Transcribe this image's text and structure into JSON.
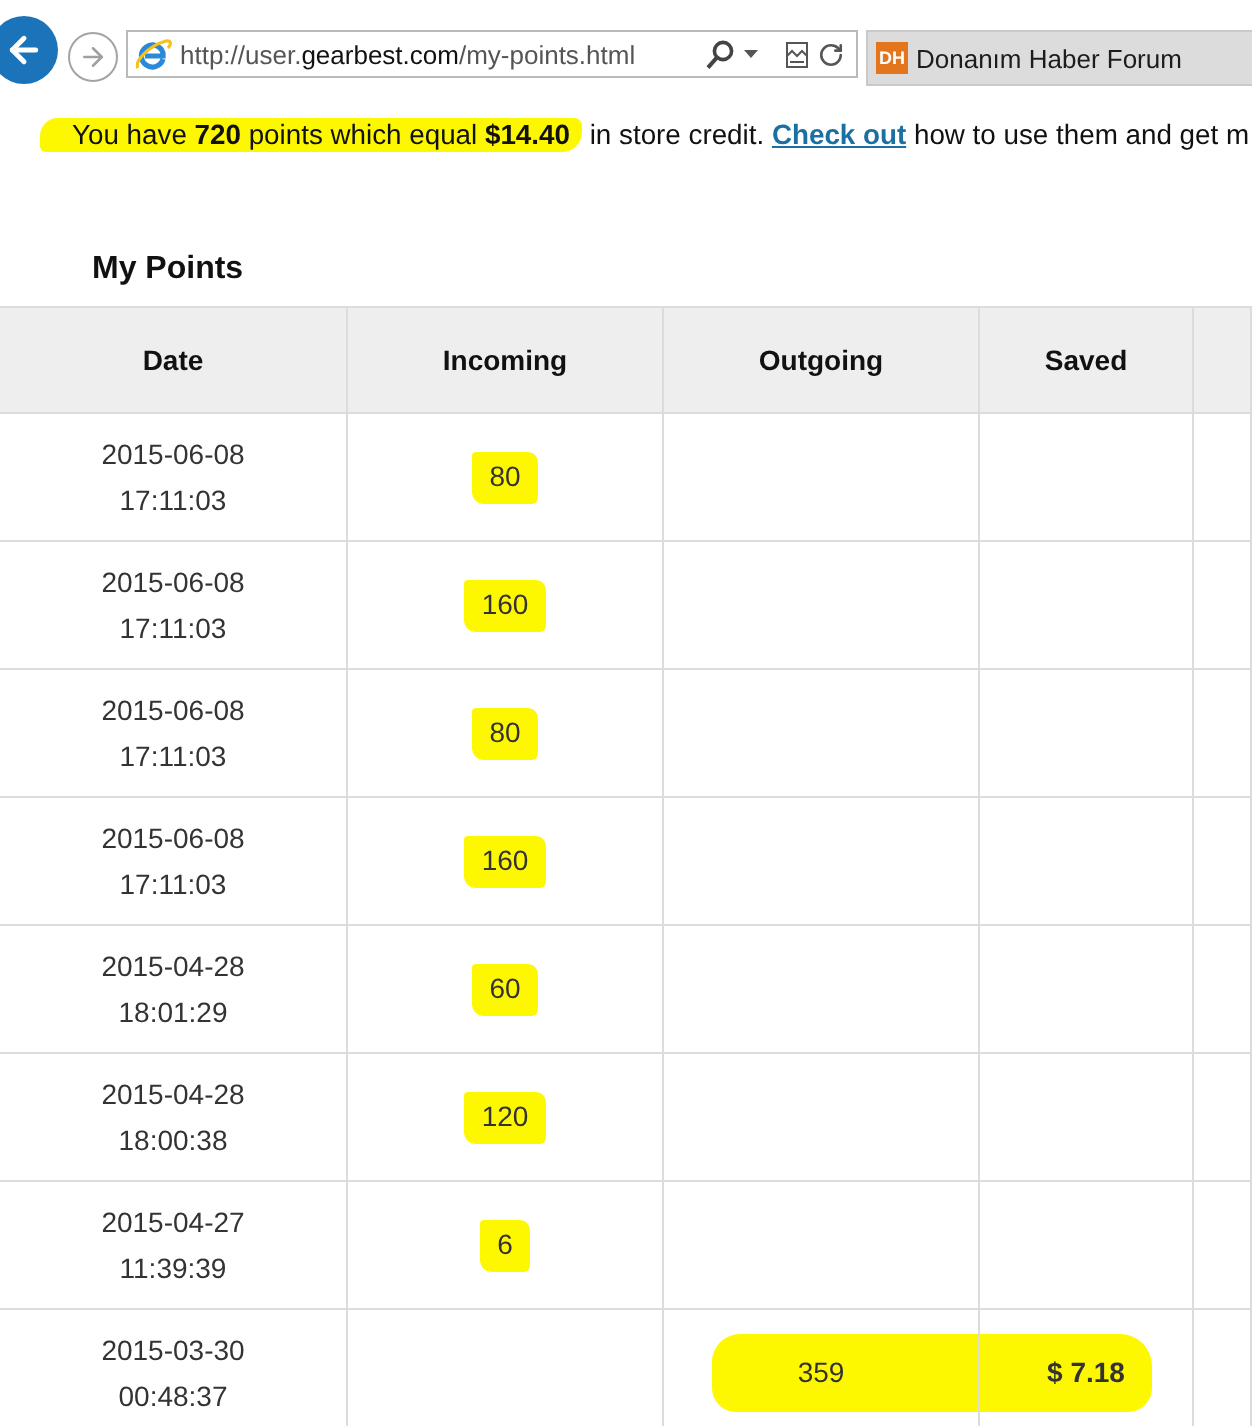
{
  "browser": {
    "url": [
      {
        "text": "http://user.",
        "kind": "dim"
      },
      {
        "text": "gearbest.com",
        "kind": "host"
      },
      {
        "text": "/my-points.html",
        "kind": "dim"
      }
    ],
    "tab": {
      "icon_text": "DH",
      "title": "Donanım Haber Forum"
    }
  },
  "notice": {
    "highlighted": "You have **720** points which equal **$14.40**",
    "text": "in store credit.",
    "link": "Check out",
    "rest": "how to use them and get m"
  },
  "section_title": "My Points",
  "table": {
    "columns": [
      "Date",
      "Incoming",
      "Outgoing",
      "Saved"
    ],
    "rows": [
      {
        "date": {
          "text": "2015-06-08 17:11:03",
          "highlighted": false
        },
        "incoming": {
          "text": "80",
          "highlighted": true
        }
      },
      {
        "date": {
          "text": "2015-06-08 17:11:03",
          "highlighted": false
        },
        "incoming": {
          "text": "160",
          "highlighted": true
        }
      },
      {
        "date": {
          "text": "2015-06-08 17:11:03",
          "highlighted": false
        },
        "incoming": {
          "text": "80",
          "highlighted": true
        }
      },
      {
        "date": {
          "text": "2015-06-08 17:11:03",
          "highlighted": false
        },
        "incoming": {
          "text": "160",
          "highlighted": true
        }
      },
      {
        "date": {
          "text": "2015-04-28 18:01:29",
          "highlighted": false
        },
        "incoming": {
          "text": "60",
          "highlighted": true
        }
      },
      {
        "date": {
          "text": "2015-04-28 18:00:38",
          "highlighted": false
        },
        "incoming": {
          "text": "120",
          "highlighted": true
        }
      },
      {
        "date": {
          "text": "2015-04-27 11:39:39",
          "highlighted": false
        },
        "incoming": {
          "text": "6",
          "highlighted": true
        }
      },
      {
        "date": {
          "text": "2015-03-30 00:48:37",
          "highlighted": false
        },
        "outgoing": {
          "text": "359",
          "highlighted": true
        },
        "saved": {
          "text": "$ 7.18",
          "highlighted": true
        }
      }
    ]
  }
}
